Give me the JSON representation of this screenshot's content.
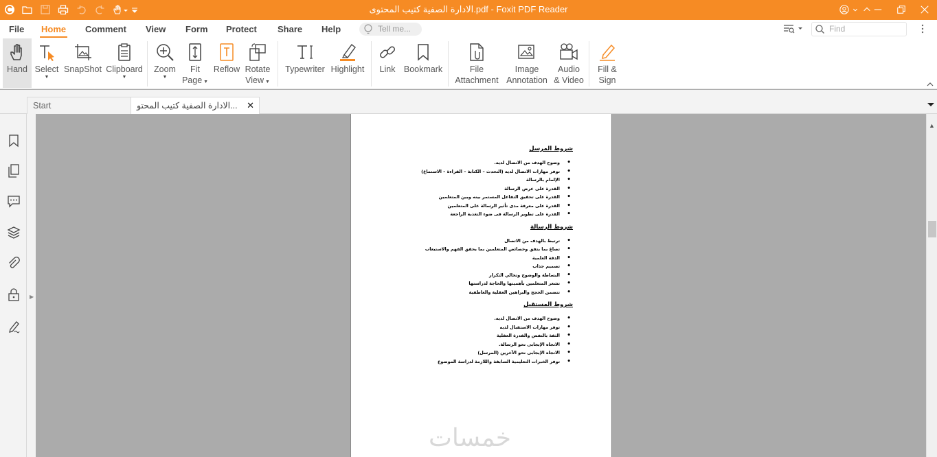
{
  "window": {
    "title": "الادارة الصفية كتيب المحتوى.pdf - Foxit PDF Reader",
    "accent_color": "#f68b24",
    "quick_access_icons": [
      "foxit-logo-icon",
      "open-folder-icon",
      "save-icon",
      "print-icon",
      "undo-icon",
      "redo-icon",
      "hand-tool-icon",
      "customize-dropdown-icon"
    ]
  },
  "menu": {
    "tabs": [
      "File",
      "Home",
      "Comment",
      "View",
      "Form",
      "Protect",
      "Share",
      "Help"
    ],
    "active_tab": "Home",
    "tell_me_placeholder": "Tell me...",
    "find_placeholder": "Find"
  },
  "ribbon": {
    "tools": [
      {
        "line1": "Hand",
        "line2": "",
        "icon": "hand-icon"
      },
      {
        "line1": "Select",
        "line2": "",
        "icon": "select-icon"
      },
      {
        "line1": "SnapShot",
        "line2": "",
        "icon": "snapshot-icon"
      },
      {
        "line1": "Clipboard",
        "line2": "",
        "icon": "clipboard-icon"
      },
      {
        "line1": "Zoom",
        "line2": "",
        "icon": "zoom-icon"
      },
      {
        "line1": "Fit",
        "line2": "Page",
        "icon": "fit-page-icon"
      },
      {
        "line1": "Reflow",
        "line2": "",
        "icon": "reflow-icon"
      },
      {
        "line1": "Rotate",
        "line2": "View",
        "icon": "rotate-view-icon"
      },
      {
        "line1": "Typewriter",
        "line2": "",
        "icon": "typewriter-icon"
      },
      {
        "line1": "Highlight",
        "line2": "",
        "icon": "highlight-icon"
      },
      {
        "line1": "Link",
        "line2": "",
        "icon": "link-icon"
      },
      {
        "line1": "Bookmark",
        "line2": "",
        "icon": "bookmark-icon"
      },
      {
        "line1": "File",
        "line2": "Attachment",
        "icon": "file-attachment-icon"
      },
      {
        "line1": "Image",
        "line2": "Annotation",
        "icon": "image-annotation-icon"
      },
      {
        "line1": "Audio",
        "line2": "& Video",
        "icon": "audio-video-icon"
      },
      {
        "line1": "Fill &",
        "line2": "Sign",
        "icon": "fill-sign-icon"
      }
    ]
  },
  "doc_tabs": {
    "start": "Start",
    "current": "الادارة الصفية كتيب المحتو..."
  },
  "document": {
    "sections": [
      {
        "heading": "شروط المرسل",
        "items": [
          "وضوح الهدف من الاتصال لديه.",
          "توفر مهارات الاتصال لديه (التحدث – الكتابة – القراءة – الاستماع)",
          "الإلمام بالرسالة",
          "القدرة على عرض الرسالة",
          "القدرة على تحقيق التفاعل المستمر بينه وبين المتعلمين",
          "القدرة على معرفة مدى تأثير الرسالة على المتعلمين",
          "القدرة على تطوير الرسالة فى ضوء التغذية الراجعة"
        ]
      },
      {
        "heading": "شروط الرسالة",
        "items": [
          "ترتبط بالهدف من الاتصال",
          "تصاغ بما يتفق وخصائص المتعلمين بما يحقق الفهم والاستيعاب",
          "الدقة العلمية",
          "تصميم جذاب",
          "البساطة والوضوح وتخالي التكرار",
          "تشعر المتعلمين بأهميتها والحاجة لدراستها",
          "تتضمن الحجج والبراهين العقلية والعاطفية"
        ]
      },
      {
        "heading": "شروط المستقبل",
        "items": [
          "وضوح الهدف من الاتصال لديه.",
          "توفر مهارات الاستقبال لديه",
          "الثقة بالنفس والقدرة العقلية",
          "الاتجاه الإيجابى نحو الرسالة.",
          "الاتجاه الإيجابى نحو الآخرين (المرسل)",
          "توفر الخبرات التعليمية السابقة واللازمة لدراسة الموضوع"
        ]
      }
    ],
    "watermark": "خمسات"
  },
  "sidebar_icons": [
    "bookmark-panel-icon",
    "pages-panel-icon",
    "comments-panel-icon",
    "layers-panel-icon",
    "attachments-panel-icon",
    "security-panel-icon",
    "signature-panel-icon"
  ]
}
